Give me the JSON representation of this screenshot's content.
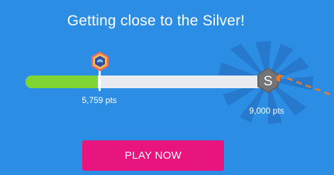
{
  "header": {
    "title": "Getting close to the Silver!"
  },
  "progress": {
    "current_points_label": "5,759 pts",
    "target_points_label": "9,000 pts",
    "current_points": 5759,
    "target_points": 9000,
    "fill_fraction": 0.3,
    "target_badge_letter": "S"
  },
  "actions": {
    "play_label": "PLAY NOW"
  },
  "colors": {
    "background": "#2c8de5",
    "progress_fill": "#7fd633",
    "progress_track": "#e8ebef",
    "play_button": "#e8157f",
    "silver_badge": "#6f6f73",
    "accent_orange": "#f07b21"
  },
  "icons": {
    "current_badge": "bronze-hexagon-badge-icon",
    "target_badge": "silver-hexagon-badge-icon"
  }
}
